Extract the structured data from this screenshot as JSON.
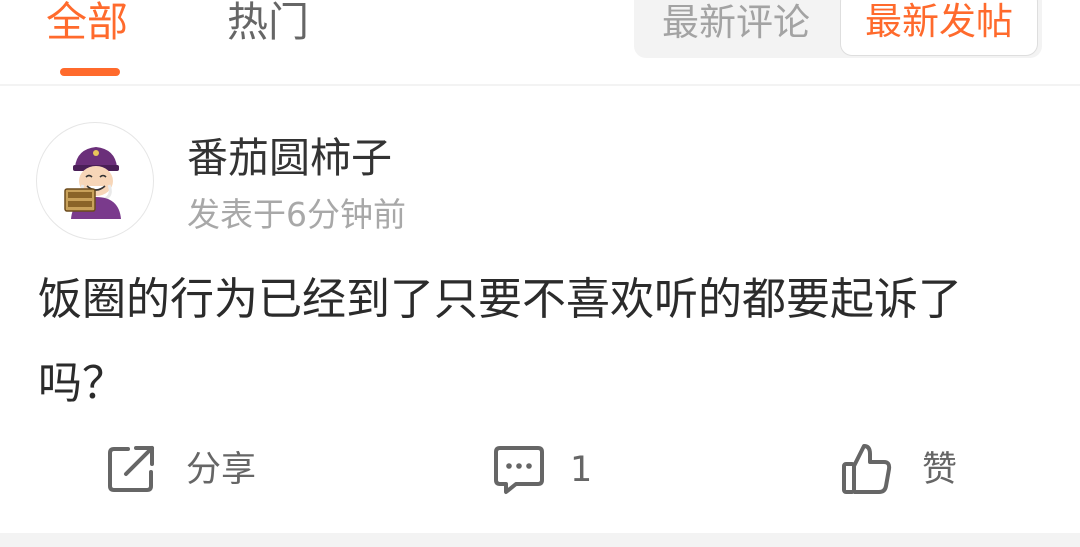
{
  "tabs": {
    "items": [
      {
        "label": "全部",
        "active": true
      },
      {
        "label": "热门",
        "active": false
      }
    ]
  },
  "sort": {
    "latest_comment": "最新评论",
    "latest_post": "最新发帖",
    "selected": "最新发帖"
  },
  "post": {
    "author": "番茄圆柿子",
    "time": "发表于6分钟前",
    "content": "饭圈的行为已经到了只要不喜欢听的都要起诉了吗？"
  },
  "actions": {
    "share_label": "分享",
    "share_icon": "share-icon",
    "comment_count": "1",
    "comment_icon": "comment-icon",
    "like_label": "赞",
    "like_icon": "thumbs-up-icon"
  },
  "colors": {
    "accent": "#ff6a2c",
    "text_primary": "#2b2b2b",
    "text_secondary": "#a8a8a8"
  }
}
